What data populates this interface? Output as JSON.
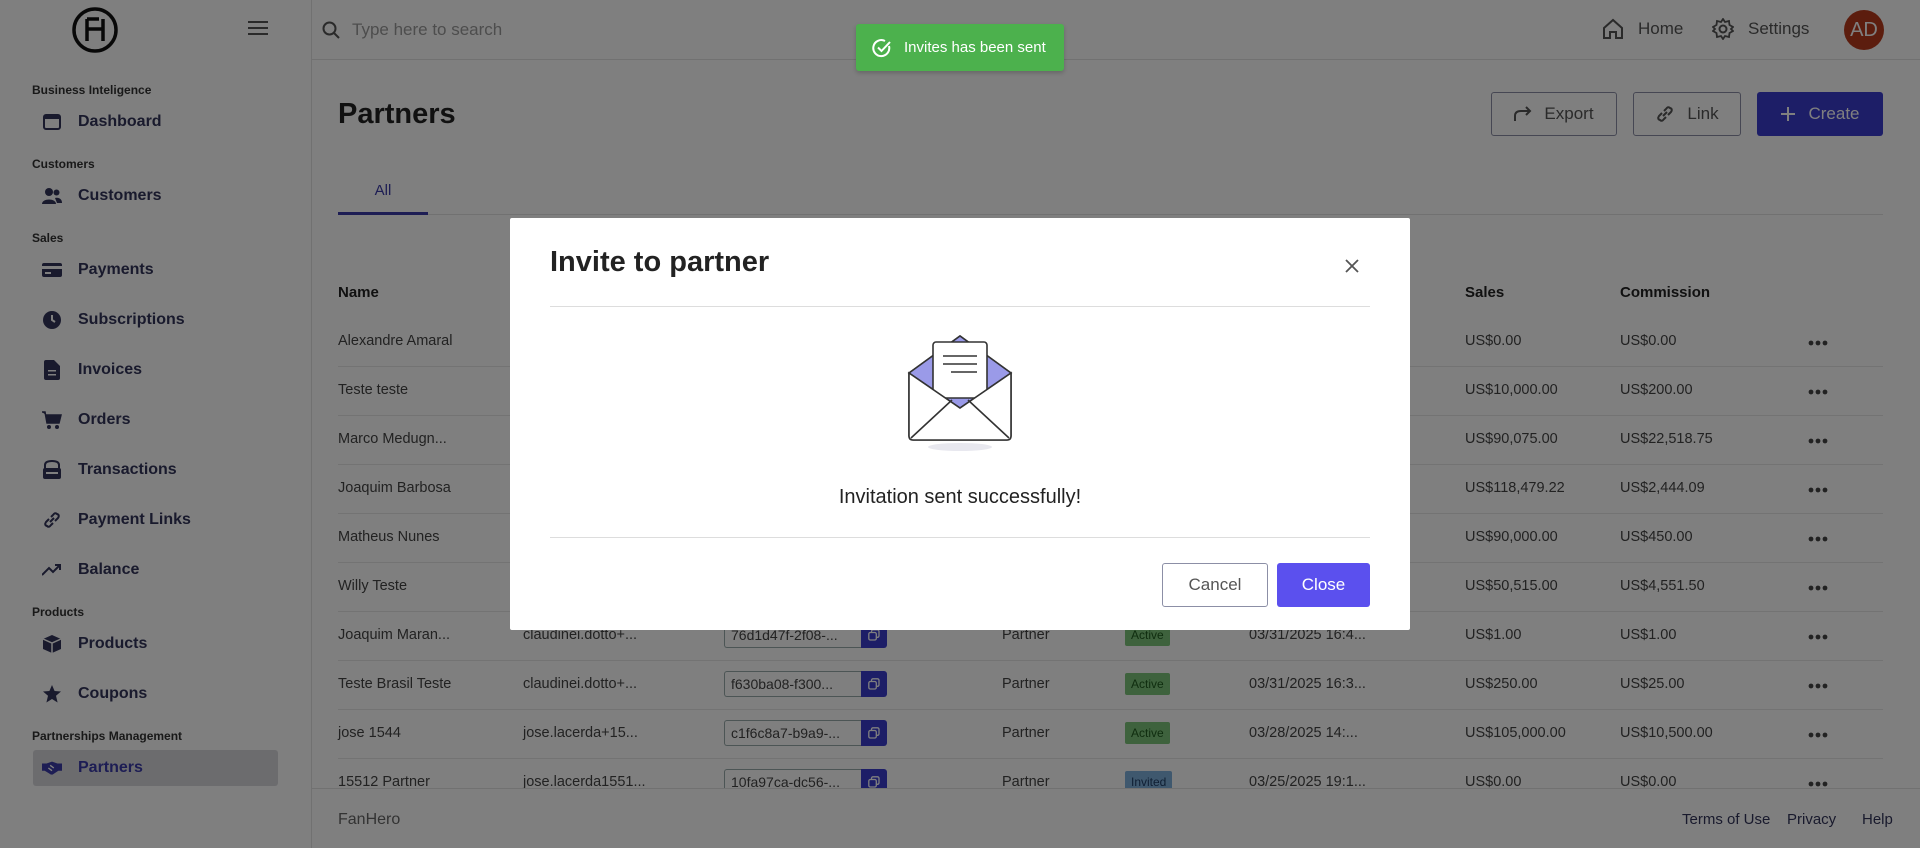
{
  "topbar": {
    "search_placeholder": "Type here to search",
    "home_label": "Home",
    "settings_label": "Settings",
    "avatar_initials": "AD"
  },
  "sidebar": {
    "sections": [
      {
        "title": "Business Inteligence",
        "items": [
          {
            "label": "Dashboard",
            "icon": "dashboard-icon"
          }
        ]
      },
      {
        "title": "Customers",
        "items": [
          {
            "label": "Customers",
            "icon": "users-icon"
          }
        ]
      },
      {
        "title": "Sales",
        "items": [
          {
            "label": "Payments",
            "icon": "credit-card-icon"
          },
          {
            "label": "Subscriptions",
            "icon": "clock-icon"
          },
          {
            "label": "Invoices",
            "icon": "document-icon"
          },
          {
            "label": "Orders",
            "icon": "cart-icon"
          },
          {
            "label": "Transactions",
            "icon": "bank-icon"
          },
          {
            "label": "Payment Links",
            "icon": "link-icon"
          },
          {
            "label": "Balance",
            "icon": "trend-icon"
          }
        ]
      },
      {
        "title": "Products",
        "items": [
          {
            "label": "Products",
            "icon": "box-icon"
          },
          {
            "label": "Coupons",
            "icon": "star-icon"
          }
        ]
      },
      {
        "title": "Partnerships Management",
        "items": [
          {
            "label": "Partners",
            "icon": "handshake-icon",
            "active": true
          }
        ]
      }
    ]
  },
  "main": {
    "title": "Partners",
    "export_label": "Export",
    "link_label": "Link",
    "create_label": "Create",
    "tab_all": "All",
    "columns": {
      "name": "Name",
      "sales": "Sales",
      "commission": "Commission"
    },
    "rows": [
      {
        "name": "Alexandre Amaral",
        "email": "",
        "id": "",
        "type": "",
        "status": "",
        "date": "",
        "sales": "US$0.00",
        "commission": "US$0.00"
      },
      {
        "name": "Teste teste",
        "email": "",
        "id": "",
        "type": "",
        "status": "",
        "date": "",
        "sales": "US$10,000.00",
        "commission": "US$200.00"
      },
      {
        "name": "Marco Medugn...",
        "email": "",
        "id": "",
        "type": "",
        "status": "",
        "date": "",
        "sales": "US$90,075.00",
        "commission": "US$22,518.75"
      },
      {
        "name": "Joaquim Barbosa",
        "email": "",
        "id": "",
        "type": "",
        "status": "",
        "date": "",
        "sales": "US$118,479.22",
        "commission": "US$2,444.09"
      },
      {
        "name": "Matheus Nunes",
        "email": "",
        "id": "",
        "type": "",
        "status": "",
        "date": "",
        "sales": "US$90,000.00",
        "commission": "US$450.00"
      },
      {
        "name": "Willy Teste",
        "email": "",
        "id": "",
        "type": "",
        "status": "",
        "date": "",
        "sales": "US$50,515.00",
        "commission": "US$4,551.50"
      },
      {
        "name": "Joaquim Maran...",
        "email": "claudinei.dotto+...",
        "id": "76d1d47f-2f08-...",
        "type": "Partner",
        "status": "Active",
        "date": "03/31/2025 16:4...",
        "sales": "US$1.00",
        "commission": "US$1.00"
      },
      {
        "name": "Teste Brasil Teste",
        "email": "claudinei.dotto+...",
        "id": "f630ba08-f300...",
        "type": "Partner",
        "status": "Active",
        "date": "03/31/2025 16:3...",
        "sales": "US$250.00",
        "commission": "US$25.00"
      },
      {
        "name": "jose 1544",
        "email": "jose.lacerda+15...",
        "id": "c1f6c8a7-b9a9-...",
        "type": "Partner",
        "status": "Active",
        "date": "03/28/2025 14:...",
        "sales": "US$105,000.00",
        "commission": "US$10,500.00"
      },
      {
        "name": "15512 Partner",
        "email": "jose.lacerda1551...",
        "id": "10fa97ca-dc56-...",
        "type": "Partner",
        "status": "Invited",
        "date": "03/25/2025 19:1...",
        "sales": "US$0.00",
        "commission": "US$0.00"
      }
    ]
  },
  "footer": {
    "brand": "FanHero",
    "terms": "Terms of Use",
    "privacy": "Privacy",
    "help": "Help"
  },
  "toast": {
    "message": "Invites has been sent"
  },
  "modal": {
    "title": "Invite to partner",
    "message": "Invitation sent successfully!",
    "cancel_label": "Cancel",
    "close_label": "Close"
  },
  "colors": {
    "primary": "#3b3ccf",
    "modal_primary": "#5b50ee",
    "toast_green": "#4cb14d",
    "avatar": "#b83a1c",
    "active_badge": "#7cc47a",
    "invited_badge": "#7fb0dd"
  }
}
